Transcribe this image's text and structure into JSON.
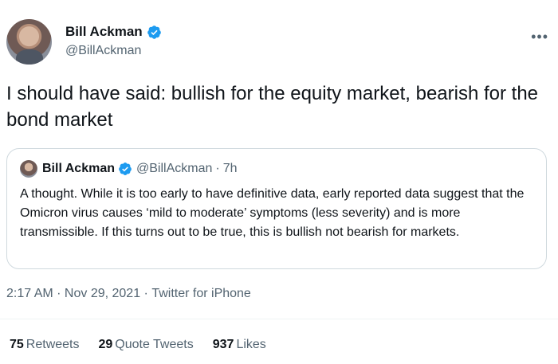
{
  "author": {
    "name": "Bill Ackman",
    "handle": "@BillAckman"
  },
  "more_icon": "more-horizontal-icon",
  "tweet_text": "I should have said: bullish for the equity market, bearish for the bond market",
  "quoted_tweet": {
    "name": "Bill Ackman",
    "handle": "@BillAckman",
    "separator": "·",
    "time": "7h",
    "text": "A thought. While it is too early to have definitive data, early reported data suggest that the Omicron virus causes ‘mild to moderate’ symptoms (less severity) and is more transmissible. If this turns out to be true, this is bullish not bearish for markets."
  },
  "meta": {
    "time": "2:17 AM",
    "sep1": " · ",
    "date": "Nov 29, 2021",
    "sep2": " · ",
    "source": "Twitter for iPhone"
  },
  "stats": {
    "retweets_count": "75",
    "retweets_label": "Retweets",
    "quotes_count": "29",
    "quotes_label": "Quote Tweets",
    "likes_count": "937",
    "likes_label": "Likes"
  },
  "colors": {
    "verified_blue": "#1d9bf0",
    "secondary_text": "#536471",
    "border": "#cfd9de"
  }
}
